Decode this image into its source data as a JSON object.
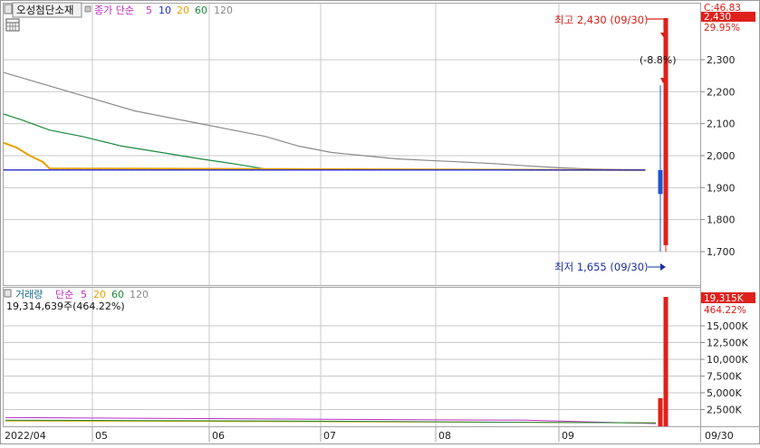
{
  "price_panel": {
    "symbol_button": "오성첨단소재",
    "legend_label": "종가 단순",
    "ma_periods": [
      "5",
      "10",
      "20",
      "60",
      "120"
    ],
    "high_annotation": "최고 2,430 (09/30)",
    "low_annotation": "최저 1,655 (09/30)",
    "change_annotation": "(-8.8%)",
    "right_top_label": "C:46.83",
    "last_price_tag": "2,430",
    "change_pct_tag": "29.95%"
  },
  "volume_panel": {
    "legend_label": "거래량",
    "legend_ma": "단순",
    "ma_periods": [
      "5",
      "20",
      "60",
      "120"
    ],
    "volume_readout": "19,314,639주(464.22%)",
    "last_volume_tag": "19,315K",
    "volume_pct_tag": "464.22%"
  },
  "colors": {
    "ma5": "#c02bc0",
    "ma10": "#1a2fd0",
    "ma20": "#e8a000",
    "ma60": "#1a8a3a",
    "ma120": "#8a8a8a",
    "up": "#e0201a",
    "down": "#1a55d0",
    "grid": "#c9c9c9",
    "axis_text": "#222222"
  },
  "chart_data": [
    {
      "type": "line",
      "title": "오성첨단소재",
      "x_tick_labels": [
        "2022/04",
        "05",
        "06",
        "07",
        "08",
        "09",
        "09/30"
      ],
      "y_tick_labels": [
        "2,300",
        "2,200",
        "2,100",
        "2,000",
        "1,900",
        "1,800",
        "1,700"
      ],
      "ylim": [
        1630,
        2430
      ],
      "grid": true,
      "series": [
        {
          "name": "120",
          "points": [
            [
              0,
              2260
            ],
            [
              0.05,
              2230
            ],
            [
              0.1,
              2200
            ],
            [
              0.15,
              2170
            ],
            [
              0.2,
              2140
            ],
            [
              0.25,
              2120
            ],
            [
              0.3,
              2100
            ],
            [
              0.35,
              2080
            ],
            [
              0.4,
              2060
            ],
            [
              0.45,
              2030
            ],
            [
              0.5,
              2010
            ],
            [
              0.55,
              2000
            ],
            [
              0.6,
              1990
            ],
            [
              0.65,
              1985
            ],
            [
              0.7,
              1980
            ],
            [
              0.75,
              1975
            ],
            [
              0.8,
              1968
            ],
            [
              0.85,
              1962
            ],
            [
              0.9,
              1958
            ],
            [
              0.98,
              1955
            ]
          ]
        },
        {
          "name": "60",
          "points": [
            [
              0,
              2130
            ],
            [
              0.03,
              2110
            ],
            [
              0.07,
              2080
            ],
            [
              0.12,
              2060
            ],
            [
              0.18,
              2030
            ],
            [
              0.24,
              2010
            ],
            [
              0.3,
              1990
            ],
            [
              0.35,
              1975
            ],
            [
              0.38,
              1965
            ],
            [
              0.4,
              1958
            ],
            [
              0.98,
              1955
            ]
          ]
        },
        {
          "name": "20",
          "points": [
            [
              0,
              2040
            ],
            [
              0.02,
              2025
            ],
            [
              0.04,
              2000
            ],
            [
              0.06,
              1980
            ],
            [
              0.07,
              1960
            ],
            [
              0.98,
              1955
            ]
          ]
        },
        {
          "name": "5",
          "points": [
            [
              0,
              1955
            ],
            [
              0.98,
              1955
            ]
          ]
        },
        {
          "name": "10",
          "points": [
            [
              0,
              1955
            ],
            [
              0.98,
              1955
            ]
          ]
        }
      ],
      "candles": [
        {
          "date": "09/30 (prev)",
          "type": "down",
          "open": 1955,
          "close": 1880,
          "high": 2220,
          "low": 1700
        },
        {
          "date": "09/30",
          "type": "up",
          "open": 1720,
          "close": 2430,
          "high": 2430,
          "low": 1700
        }
      ],
      "annotations": {
        "high": 2430,
        "low": 1655,
        "change_pct": -8.8
      }
    },
    {
      "type": "bar",
      "title": "거래량",
      "y_tick_labels": [
        "15,000K",
        "12,500K",
        "10,000K",
        "7,500K",
        "5,000K",
        "2,500K"
      ],
      "ylim": [
        0,
        20000
      ],
      "grid": true,
      "bars": [
        {
          "date": "09/29",
          "value": 4200,
          "color": "up"
        },
        {
          "date": "09/30",
          "value": 19315,
          "color": "up"
        }
      ],
      "ma_lines": [
        {
          "name": "5",
          "values_k": [
            1300,
            1200,
            1100,
            1000,
            900,
            400
          ]
        },
        {
          "name": "20",
          "values_k": [
            800,
            750,
            700,
            650,
            600,
            500
          ]
        },
        {
          "name": "60",
          "values_k": [
            900,
            850,
            800,
            700,
            600,
            500
          ]
        }
      ]
    }
  ]
}
